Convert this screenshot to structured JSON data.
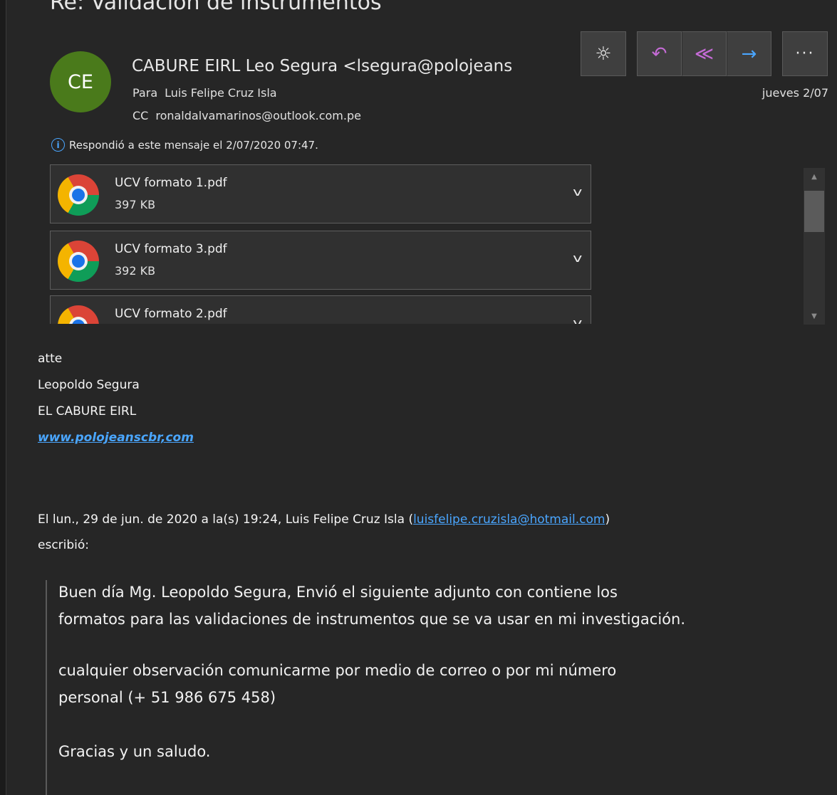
{
  "email": {
    "subject": "Re: Validación de instrumentos",
    "avatar_initials": "CE",
    "sender": "CABURE EIRL Leo Segura <lsegura@polojeans",
    "to_label": "Para",
    "to": "Luis Felipe Cruz Isla",
    "cc_label": "CC",
    "cc": "ronaldalvamarinos@outlook.com.pe",
    "date": "jueves 2/07",
    "info": "Respondió a este mensaje el 2/07/2020 07:47."
  },
  "toolbar": {
    "brightness_icon": "☼",
    "reply_icon": "↶",
    "reply_all_icon": "≪",
    "forward_icon": "→",
    "more_icon": "···"
  },
  "attachments": [
    {
      "name": "UCV formato 1.pdf",
      "size": "397 KB"
    },
    {
      "name": "UCV formato 3.pdf",
      "size": "392 KB"
    },
    {
      "name": "UCV formato 2.pdf",
      "size": ""
    }
  ],
  "body": {
    "sig1": "atte",
    "sig2": "Leopoldo Segura",
    "sig3": "EL CABURE EIRL",
    "sig_link": "www.polojeanscbr,com",
    "quote_header_pre": "El lun., 29 de jun. de 2020 a la(s) 19:24, Luis Felipe Cruz Isla (",
    "quote_header_email": "luisfelipe.cruzisla@hotmail.com",
    "quote_header_post": ")",
    "quote_header_line2": "escribió:",
    "quote": [
      "Buen día Mg. Leopoldo Segura, Envió el siguiente adjunto con contiene los",
      "formatos para las validaciones de instrumentos que se va usar en mi investigación.",
      "cualquier observación comunicarme por medio de correo o por mi número",
      "personal (+ 51 986 675 458)",
      "Gracias y un saludo."
    ]
  },
  "colors": {
    "background": "#262626",
    "link": "#4aa6ff",
    "avatar": "#4a7a1b",
    "reply_accent": "#c56bd6"
  }
}
